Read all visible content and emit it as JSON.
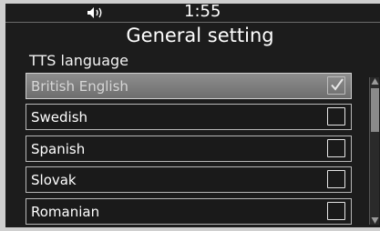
{
  "status_bar": {
    "clock": "1:55",
    "volume_icon": "speaker-volume-icon"
  },
  "header": {
    "title": "General setting"
  },
  "section": {
    "label": "TTS language"
  },
  "languages": [
    {
      "label": "British English",
      "checked": true
    },
    {
      "label": "Swedish",
      "checked": false
    },
    {
      "label": "Spanish",
      "checked": false
    },
    {
      "label": "Slovak",
      "checked": false
    },
    {
      "label": "Romanian",
      "checked": false
    }
  ],
  "colors": {
    "background": "#1c1c1c",
    "bezel": "#cfcfcf",
    "selected_row": "#7e7e7e",
    "text": "#ffffff"
  }
}
